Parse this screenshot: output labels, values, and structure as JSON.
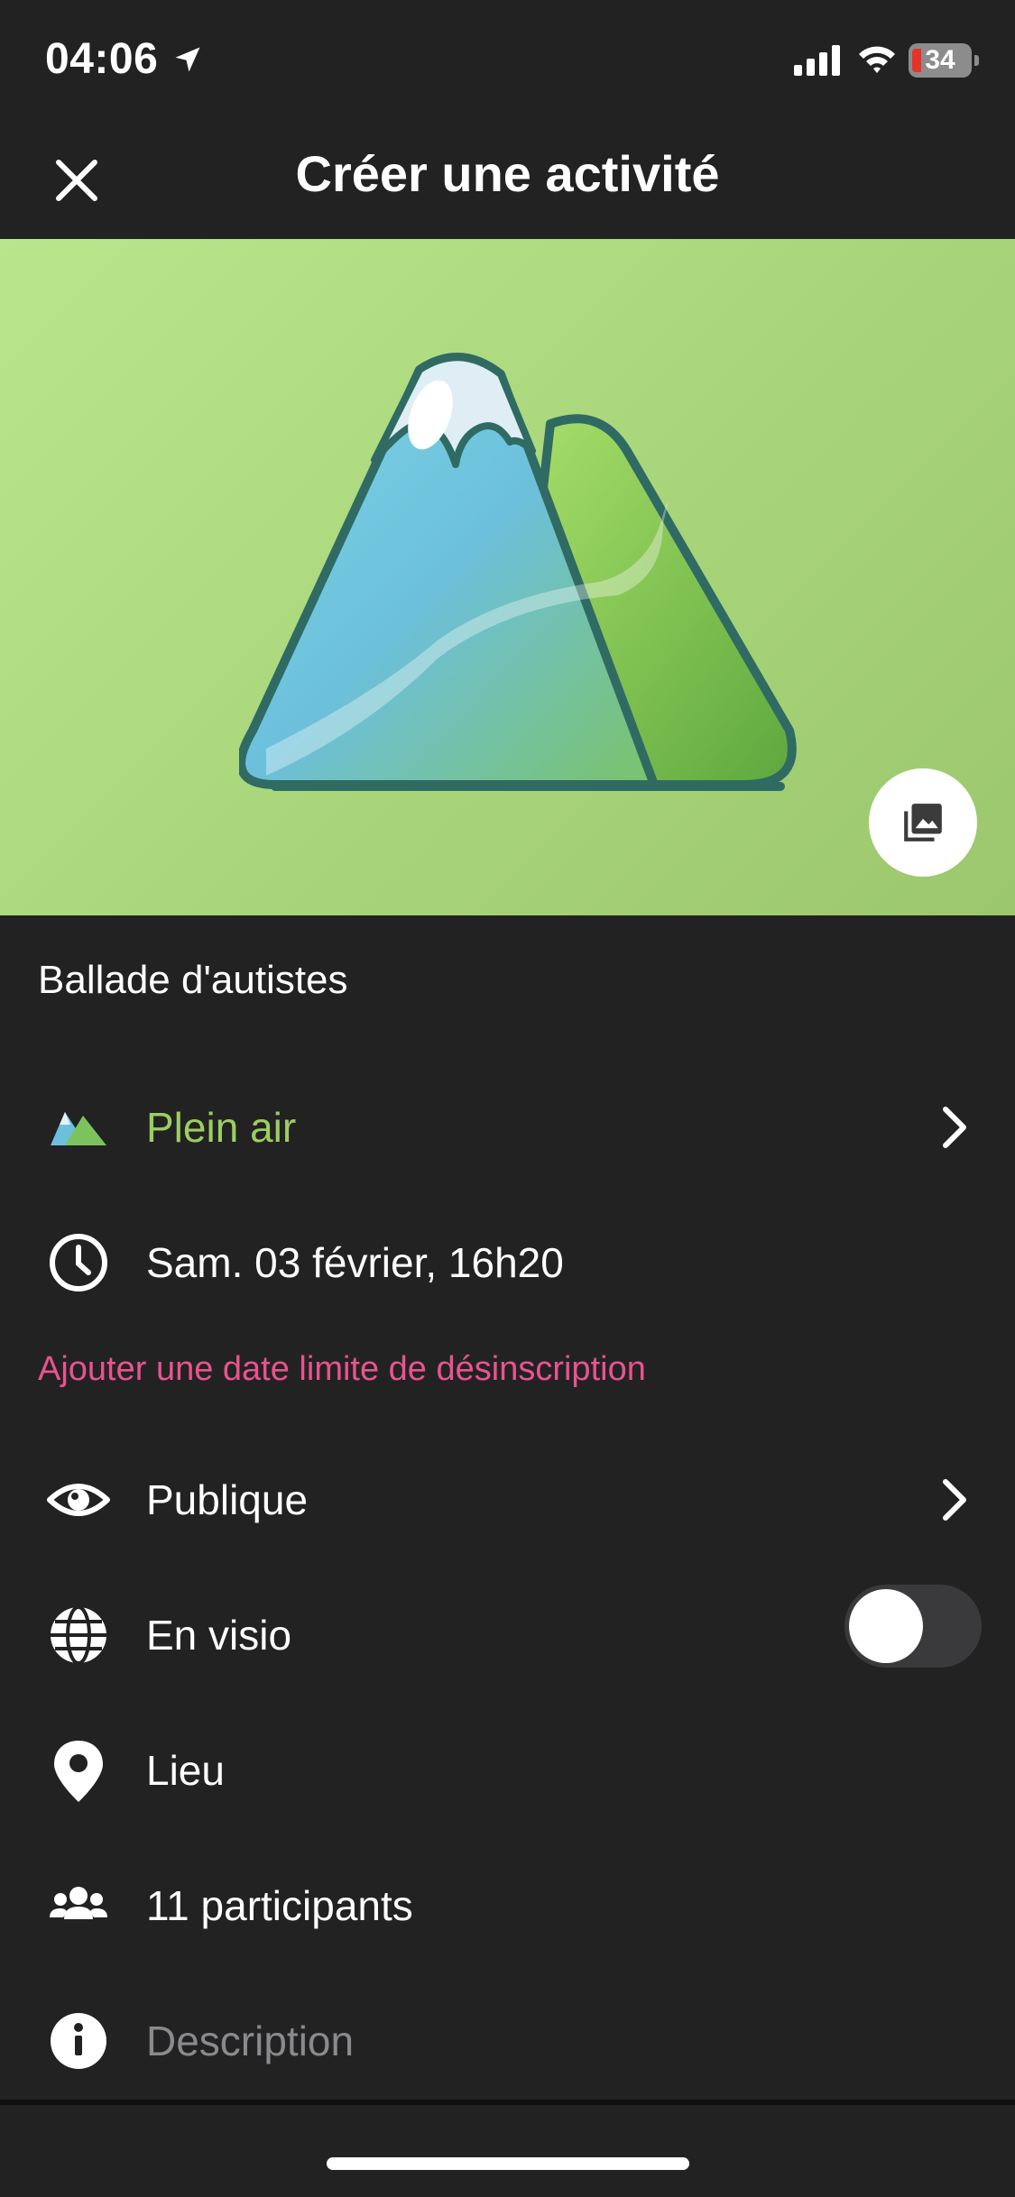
{
  "status": {
    "time": "04:06",
    "battery": "34"
  },
  "header": {
    "title": "Créer une activité"
  },
  "activity": {
    "name": "Ballade d'autistes"
  },
  "category": {
    "label": "Plein air"
  },
  "datetime": {
    "label": "Sam. 03 février, 16h20"
  },
  "deadline": {
    "label": "Ajouter une date limite de désinscription"
  },
  "visibility": {
    "label": "Publique"
  },
  "visio": {
    "label": "En visio",
    "enabled": false
  },
  "location": {
    "label": "Lieu"
  },
  "participants": {
    "label": "11 participants"
  },
  "description": {
    "placeholder": "Description"
  },
  "colors": {
    "accent_green": "#9ccd62",
    "accent_pink": "#e8548f",
    "background": "#222222",
    "cover_green": "#a9d57a"
  },
  "icons": [
    "location-arrow-icon",
    "signal-icon",
    "wifi-icon",
    "battery-icon",
    "close-icon",
    "mountain-illustration",
    "photo-icon",
    "category-mountain-icon",
    "clock-icon",
    "eye-icon",
    "globe-icon",
    "map-pin-icon",
    "users-icon",
    "info-icon",
    "chevron-right-icon"
  ]
}
